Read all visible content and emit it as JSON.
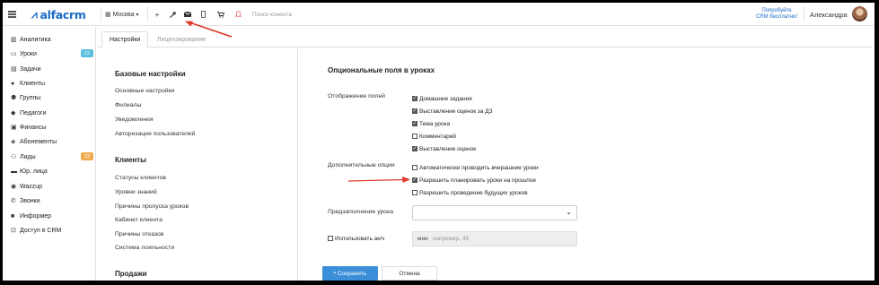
{
  "header": {
    "logo": "alfacrm",
    "city": "Москва",
    "search_placeholder": "Поиск клиента",
    "promo_line1": "Попробуйте",
    "promo_line2": "CRM бесплатно!",
    "user_name": "Александра"
  },
  "sidebar": {
    "items": [
      {
        "label": "Аналитика",
        "icon": "analytics-icon"
      },
      {
        "label": "Уроки",
        "icon": "calendar-icon",
        "badge": "12"
      },
      {
        "label": "Задачи",
        "icon": "tasks-icon"
      },
      {
        "label": "Клиенты",
        "icon": "user-icon"
      },
      {
        "label": "Группы",
        "icon": "users-icon"
      },
      {
        "label": "Педагоги",
        "icon": "graduation-cap-icon"
      },
      {
        "label": "Финансы",
        "icon": "money-icon"
      },
      {
        "label": "Абонементы",
        "icon": "tag-icon"
      },
      {
        "label": "Лиды",
        "icon": "user-plus-icon",
        "badge": "23"
      },
      {
        "label": "Юр. лица",
        "icon": "briefcase-icon"
      },
      {
        "label": "Wazzup",
        "icon": "whatsapp-icon"
      },
      {
        "label": "Звонки",
        "icon": "phone-icon"
      },
      {
        "label": "Информер",
        "icon": "informer-icon"
      },
      {
        "label": "Доступ в CRM",
        "icon": "lock-icon"
      }
    ]
  },
  "tabs": {
    "settings": "Настройки",
    "licensing": "Лицензирование"
  },
  "menu": {
    "basic_title": "Базовые настройки",
    "basic_items": [
      "Основные настройки",
      "Филиалы",
      "Уведомления",
      "Авторизация пользователей"
    ],
    "clients_title": "Клиенты",
    "clients_items": [
      "Статусы клиентов",
      "Уровни знаний",
      "Причины пропуска уроков",
      "Кабинет клиента",
      "Причины отказов",
      "Система лояльности"
    ],
    "sales_title": "Продажи"
  },
  "content": {
    "title": "Опциональные поля в уроках",
    "display_label": "Отображение полей",
    "display_fields": [
      {
        "label": "Домашние задания",
        "checked": true
      },
      {
        "label": "Выставление оценок за ДЗ",
        "checked": true
      },
      {
        "label": "Тема урока",
        "checked": true
      },
      {
        "label": "Комментарий",
        "checked": false
      },
      {
        "label": "Выставление оценок",
        "checked": true
      }
    ],
    "extra_label": "Дополнительные опции",
    "extra_options": [
      {
        "label": "Автоматически проводить вчерашние уроки",
        "checked": false
      },
      {
        "label": "Разрешить планировать уроки на прошлое",
        "checked": true
      },
      {
        "label": "Разрешить проведение будущих уроков",
        "checked": false
      }
    ],
    "prefill_label": "Предзаполнение урока",
    "prefill_value": "",
    "use_label": "Использовать ак/ч",
    "mins_unit": "мин",
    "mins_placeholder": "например, 45",
    "save_label": "Сохранить",
    "cancel_label": "Отмена"
  },
  "colors": {
    "brand": "#1a6bc7",
    "primary_button": "#3b8fd8",
    "annotation_arrow": "#e0392b",
    "badge_blue": "#5bc0de",
    "badge_orange": "#f0ad4e"
  }
}
